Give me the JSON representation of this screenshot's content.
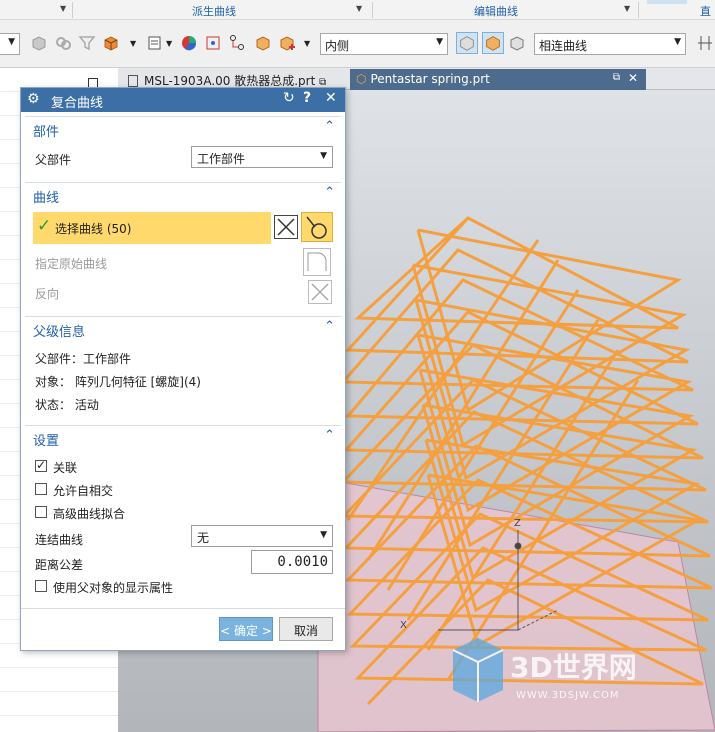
{
  "ribbon": {
    "group_derived": "派生曲线",
    "group_edit": "编辑曲线",
    "group_right": "直线"
  },
  "toolbar": {
    "side_dropdown": "内侧",
    "curve_type_dropdown": "相连曲线"
  },
  "tabs": [
    {
      "label": "MSL-1903A.00 散热器总成.prt"
    },
    {
      "label": "Pentastar spring.prt"
    }
  ],
  "dialog": {
    "title": "复合曲线",
    "sections": {
      "parts": {
        "header": "部件",
        "parent_label": "父部件",
        "parent_value": "工作部件"
      },
      "curves": {
        "header": "曲线",
        "select_label": "选择曲线 (50)",
        "specify_original": "指定原始曲线",
        "reverse": "反向"
      },
      "parent_info": {
        "header": "父级信息",
        "parent_line": "父部件：工作部件",
        "object_line": "对象：  阵列几何特征 [螺旋](4)",
        "status_line": "状态：  活动"
      },
      "settings": {
        "header": "设置",
        "associative": "关联",
        "allow_self_intersect": "允许自相交",
        "advanced_fit": "高级曲线拟合",
        "join_label": "连结曲线",
        "join_value": "无",
        "tolerance_label": "距离公差",
        "tolerance_value": "0.0010",
        "use_parent_display": "使用父对象的显示属性"
      }
    },
    "ok_label": "< 确定 >",
    "cancel_label": "取消"
  },
  "watermark": {
    "brand": "3D世界网",
    "url": "WWW.3DSJW.COM"
  },
  "colors": {
    "title_bar": "#3c6fa5",
    "section_header_text": "#1f5fa8",
    "selection_highlight": "#ffd96b",
    "curve_orange": "#f5a040",
    "active_tab": "#4d6b8c"
  }
}
